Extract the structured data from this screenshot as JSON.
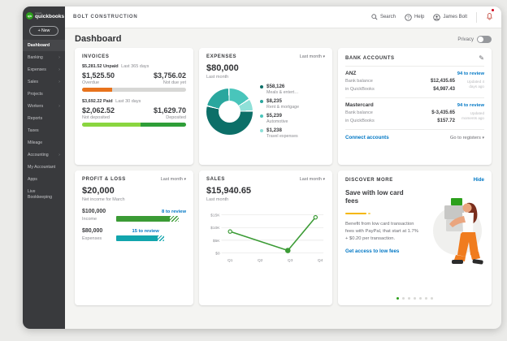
{
  "sidebar": {
    "logo_top": "intuit",
    "logo_text": "quickbooks",
    "logo_mark": "qb",
    "new_button": "+ New",
    "items": [
      {
        "label": "Dashboard"
      },
      {
        "label": "Banking"
      },
      {
        "label": "Expenses"
      },
      {
        "label": "Sales"
      },
      {
        "label": "Projects"
      },
      {
        "label": "Workers"
      },
      {
        "label": "Reports"
      },
      {
        "label": "Taxes"
      },
      {
        "label": "Mileage"
      },
      {
        "label": "Accounting"
      },
      {
        "label": "My Accountant"
      },
      {
        "label": "Apps"
      },
      {
        "label": "Live Bookkeeping"
      }
    ]
  },
  "topbar": {
    "company": "BOLT CONSTRUCTION",
    "search": "Search",
    "help": "Help",
    "user": "James Bolt"
  },
  "page": {
    "title": "Dashboard",
    "privacy": "Privacy"
  },
  "invoices": {
    "title": "INVOICES",
    "unpaid": {
      "amount": "$5,281.52",
      "label": "Unpaid",
      "period": "Last 365 days",
      "left_amount": "$1,525.50",
      "left_label": "Overdue",
      "right_amount": "$3,756.02",
      "right_label": "Not due yet",
      "bar_color": "#e8731c",
      "bar_pct": 29
    },
    "paid": {
      "amount": "$3,692.22",
      "label": "Paid",
      "period": "Last 30 days",
      "left_amount": "$2,062.52",
      "left_label": "Not deposited",
      "right_amount": "$1,629.70",
      "right_label": "Deposited",
      "left_color": "#8ad53f",
      "right_color": "#2e9e38",
      "left_pct": 56
    }
  },
  "expenses": {
    "title": "EXPENSES",
    "filter": "Last month",
    "total": "$80,000",
    "period": "Last month",
    "chart_data": {
      "type": "pie",
      "total": 80000,
      "slices": [
        {
          "display": "$58,126",
          "value": 58126,
          "label": "Meals & entert…",
          "color": "#0c6f68"
        },
        {
          "display": "$8,235",
          "value": 8235,
          "label": "Rent & mortgage",
          "color": "#2aa79e"
        },
        {
          "display": "$5,239",
          "value": 5239,
          "label": "Automotive",
          "color": "#49c5bb"
        },
        {
          "display": "$1,238",
          "value": 1238,
          "label": "Travel expenses",
          "color": "#8fe0d8"
        }
      ]
    }
  },
  "bank": {
    "title": "BANK ACCOUNTS",
    "accounts": [
      {
        "name": "ANZ",
        "review": "94 to review",
        "bank_label": "Bank balance",
        "bank_value": "$12,435.65",
        "qb_label": "in QuickBooks",
        "qb_value": "$4,987.43",
        "updated": "Updated 4 days ago"
      },
      {
        "name": "Mastercard",
        "review": "94 to review",
        "bank_label": "Bank balance",
        "bank_value": "$-3,435.65",
        "qb_label": "in QuickBooks",
        "qb_value": "$157.72",
        "updated": "Updated moments ago"
      }
    ],
    "connect": "Connect accounts",
    "registers": "Go to registers"
  },
  "pnl": {
    "title": "PROFIT & LOSS",
    "filter": "Last month",
    "net": "$20,000",
    "net_label": "Net income for March",
    "income": {
      "amount": "$100,000",
      "label": "Income",
      "review": "8 to review",
      "color": "#3b9b35",
      "solid_pct": 77,
      "hatch_pct": 13
    },
    "expenses": {
      "amount": "$80,000",
      "label": "Expenses",
      "review": "15 to review",
      "color": "#12a5ad",
      "solid_pct": 59,
      "hatch_pct": 10
    }
  },
  "sales": {
    "title": "SALES",
    "filter": "Last month",
    "total": "$15,940.65",
    "period": "Last month",
    "chart_data": {
      "type": "line",
      "categories": [
        "Q1",
        "Q2",
        "Q3",
        "Q4"
      ],
      "y_ticks": [
        "$15K",
        "$10K",
        "$5K",
        "$0"
      ],
      "ylim": [
        0,
        15000
      ],
      "points": [
        {
          "x": 1.0,
          "y": 8500
        },
        {
          "x": 2.9,
          "y": 1000
        },
        {
          "x": 3.85,
          "y": 14000
        }
      ],
      "line_color": "#3b9b35"
    }
  },
  "discover": {
    "title": "DISCOVER MORE",
    "hide": "Hide",
    "heading": "Save with low card fees",
    "body": "Benefit from low card transaction fees with PayPal, that start at 1.7% + $0.20 per transaction.",
    "cta": "Get access to low fees",
    "dot_count": 7
  }
}
